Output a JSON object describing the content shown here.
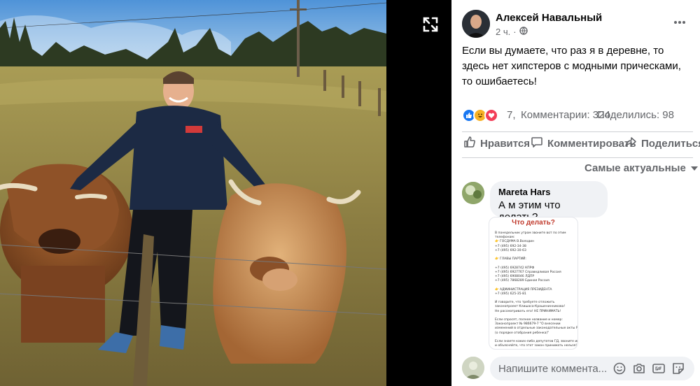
{
  "post": {
    "author": "Алексей Навальный",
    "time": "2 ч.",
    "privacy_icon": "globe-icon",
    "text": "Если вы думаете, что раз я в деревне, то здесь нет хипстеров с модными прическами, то ошибаетесь!"
  },
  "stats": {
    "reactions": "7,",
    "comments": "Комментарии: 324",
    "shares": "Поделились: 98"
  },
  "actions": {
    "like": "Нравится",
    "comment": "Комментировать",
    "share": "Поделиться"
  },
  "sort": {
    "label": "Самые актуальные"
  },
  "comment": {
    "author": "Mareta Hars",
    "text": "А м этим что делать?",
    "image": {
      "title": "Что делать?",
      "lines": [
        "В понедельник утром звоните вот по этим",
        "телефонам:",
        "👉 ГОСДУМА В.Володин",
        "+7 (495) 692-34-38",
        "+7 (495) 692-30-63",
        "",
        "👉 ГЛАВЫ ПАРТИЙ:",
        "",
        "+7 (495) 6928742 КПРФ",
        "+7 (495) 6927767 Справедливая Россия",
        "+7 (495) 6908046 ЛДПР",
        "+7 (495) 7868289 Единая Россия",
        "",
        "👉 АДМИНИСТРАЦИЯ ПРЕЗИДЕНТА",
        "+7 (495) 625-35-81",
        "",
        "И говорите, что требуете отложить",
        "законопроект Клишаса-Крашенинникова!",
        "Не рассматривать его! НЕ ПРИНИМАТЬ!",
        "",
        "Если спросят, полное название и номер:",
        "Законопроект № 986679-7 \"О внесении",
        "изменений в отдельные законодательные акты РФ",
        "(о порядке отобрания ребенка)\"",
        "",
        "Если знаете каких-либо депутатов ГД, звоните им",
        "и объясняйте, что этот закон принимать нельзя!"
      ]
    }
  },
  "composer": {
    "placeholder": "Напишите коммента..."
  },
  "icons": {
    "expand": "expand-icon",
    "more": "more-dots-icon",
    "like": "thumbs-up-icon",
    "comment": "speech-bubble-icon",
    "share": "share-arrow-icon",
    "sort": "caret-down-icon",
    "emoji": "emoji-icon",
    "camera": "camera-icon",
    "gif": "gif-icon",
    "sticker": "sticker-icon"
  },
  "colors": {
    "reaction_like": "#1877f2",
    "reaction_haha": "#f7b125",
    "reaction_love": "#f33e58",
    "image_title": "#c0392b"
  }
}
